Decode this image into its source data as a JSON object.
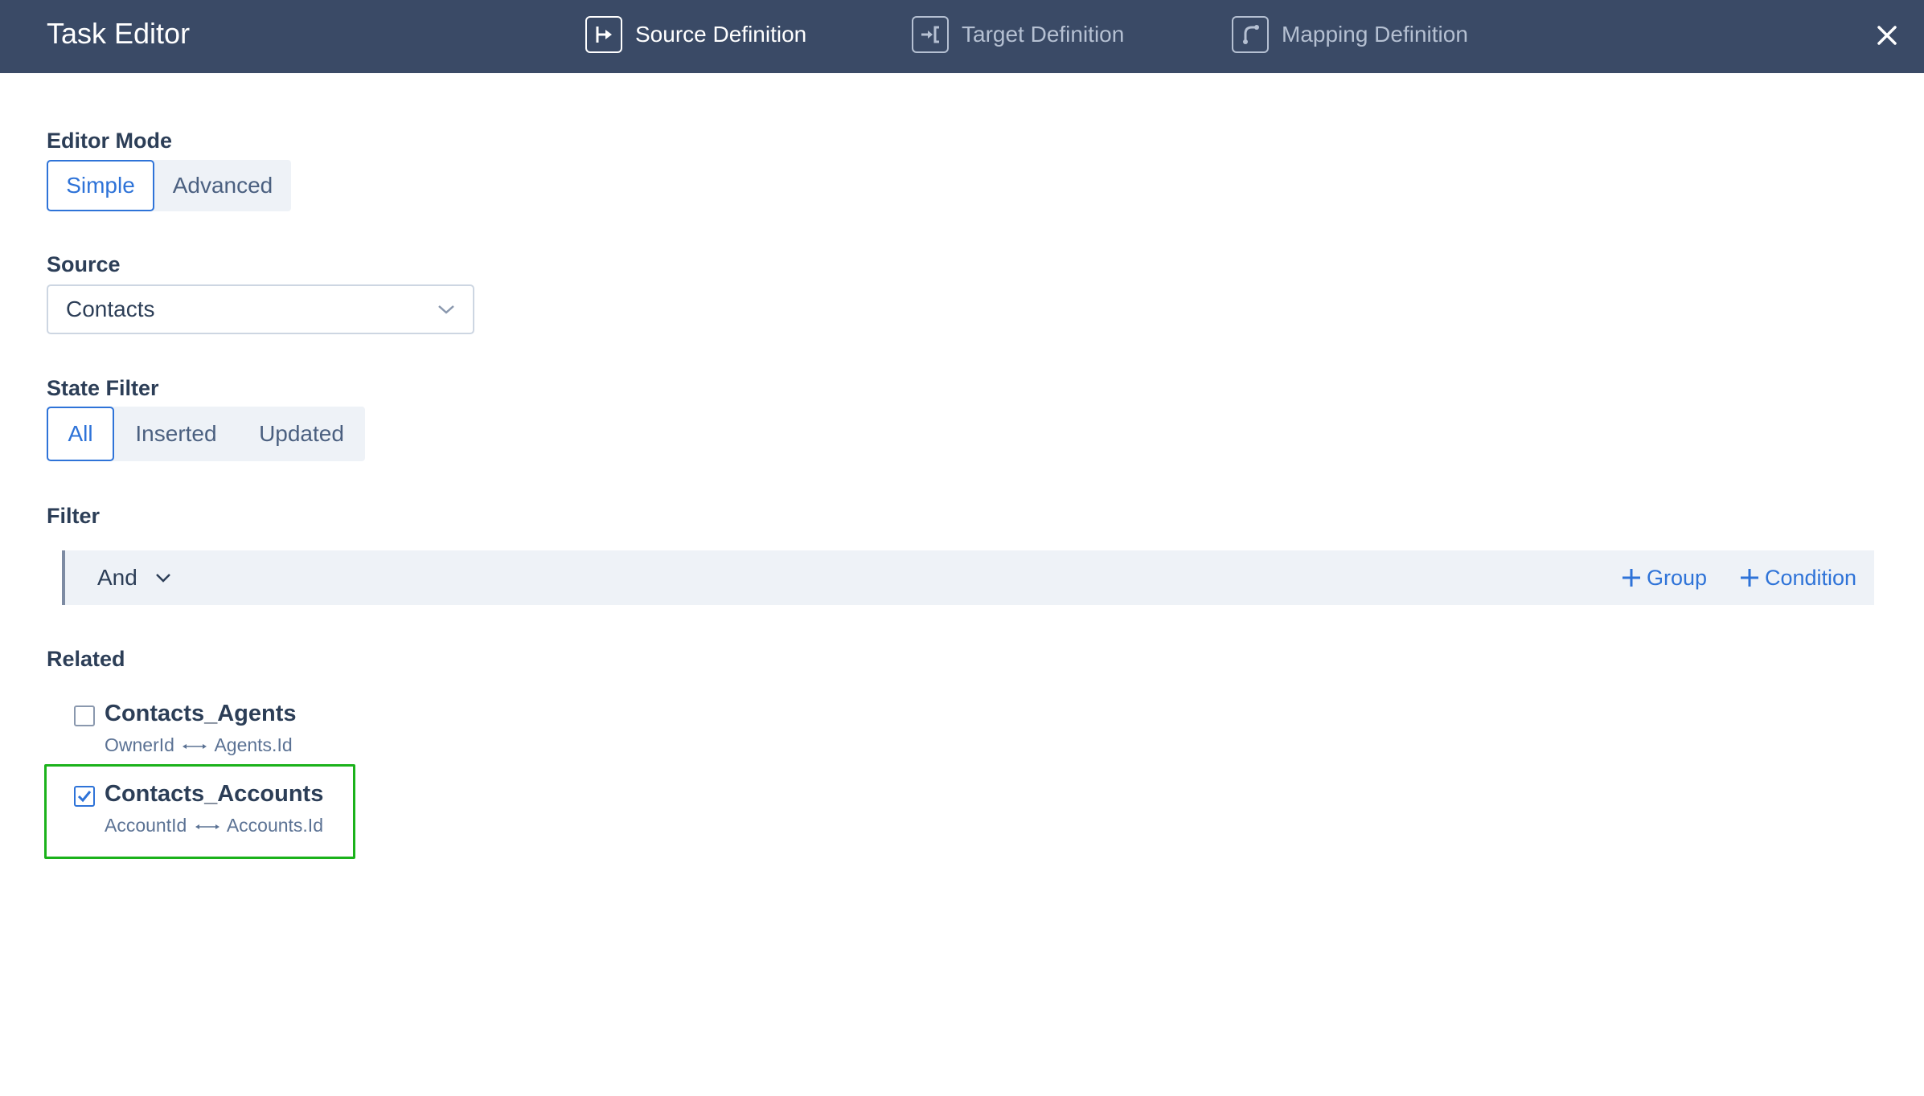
{
  "app": {
    "title": "Task Editor"
  },
  "tabs": [
    {
      "label": "Source Definition",
      "icon": "source-definition-icon",
      "active": true
    },
    {
      "label": "Target Definition",
      "icon": "target-definition-icon",
      "active": false
    },
    {
      "label": "Mapping Definition",
      "icon": "mapping-definition-icon",
      "active": false
    }
  ],
  "close_icon": "close-icon",
  "editor_mode": {
    "label": "Editor Mode",
    "options": [
      "Simple",
      "Advanced"
    ],
    "selected": "Simple"
  },
  "source": {
    "label": "Source",
    "value": "Contacts"
  },
  "state_filter": {
    "label": "State Filter",
    "options": [
      "All",
      "Inserted",
      "Updated"
    ],
    "selected": "All"
  },
  "filter": {
    "label": "Filter",
    "operator": "And",
    "add_group_label": "Group",
    "add_condition_label": "Condition"
  },
  "related": {
    "label": "Related",
    "items": [
      {
        "name": "Contacts_Agents",
        "left_key": "OwnerId",
        "right_key": "Agents.Id",
        "checked": false
      },
      {
        "name": "Contacts_Accounts",
        "left_key": "AccountId",
        "right_key": "Accounts.Id",
        "checked": true
      }
    ]
  },
  "colors": {
    "header_bg": "#3a4a66",
    "accent": "#2e73d8",
    "highlight": "#1bb21b"
  }
}
